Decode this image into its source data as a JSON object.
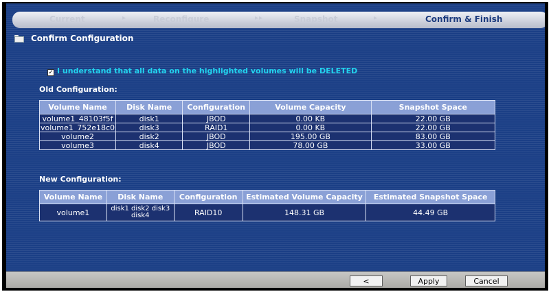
{
  "wizard": {
    "steps": [
      "Current",
      "Reconfigure",
      "Snapshot",
      "Confirm & Finish"
    ],
    "active_step": "Confirm & Finish"
  },
  "page_title": "Confirm Configuration",
  "confirm": {
    "checked": true,
    "label": "I understand that all data on the highlighted volumes will be DELETED"
  },
  "old_config": {
    "label": "Old Configuration:",
    "columns": [
      "Volume Name",
      "Disk Name",
      "Configuration",
      "Volume Capacity",
      "Snapshot Space"
    ],
    "rows": [
      [
        "volume1_48103f5f",
        "disk1",
        "JBOD",
        "0.00 KB",
        "22.00 GB"
      ],
      [
        "volume1_752e18c0",
        "disk3",
        "RAID1",
        "0.00 KB",
        "22.00 GB"
      ],
      [
        "volume2",
        "disk2",
        "JBOD",
        "195.00 GB",
        "83.00 GB"
      ],
      [
        "volume3",
        "disk4",
        "JBOD",
        "78.00 GB",
        "33.00 GB"
      ]
    ]
  },
  "new_config": {
    "label": "New Configuration:",
    "columns": [
      "Volume Name",
      "Disk Name",
      "Configuration",
      "Estimated Volume Capacity",
      "Estimated Snapshot Space"
    ],
    "rows": [
      [
        "volume1",
        "disk1 disk2 disk3 disk4",
        "RAID10",
        "148.31 GB",
        "44.49 GB"
      ]
    ]
  },
  "buttons": {
    "back": "< Back",
    "apply": "Apply",
    "cancel": "Cancel"
  },
  "colors": {
    "panel_background": "#1b3f86",
    "header_cell": "#8aa0d6",
    "warning_text": "#22d3ee"
  }
}
